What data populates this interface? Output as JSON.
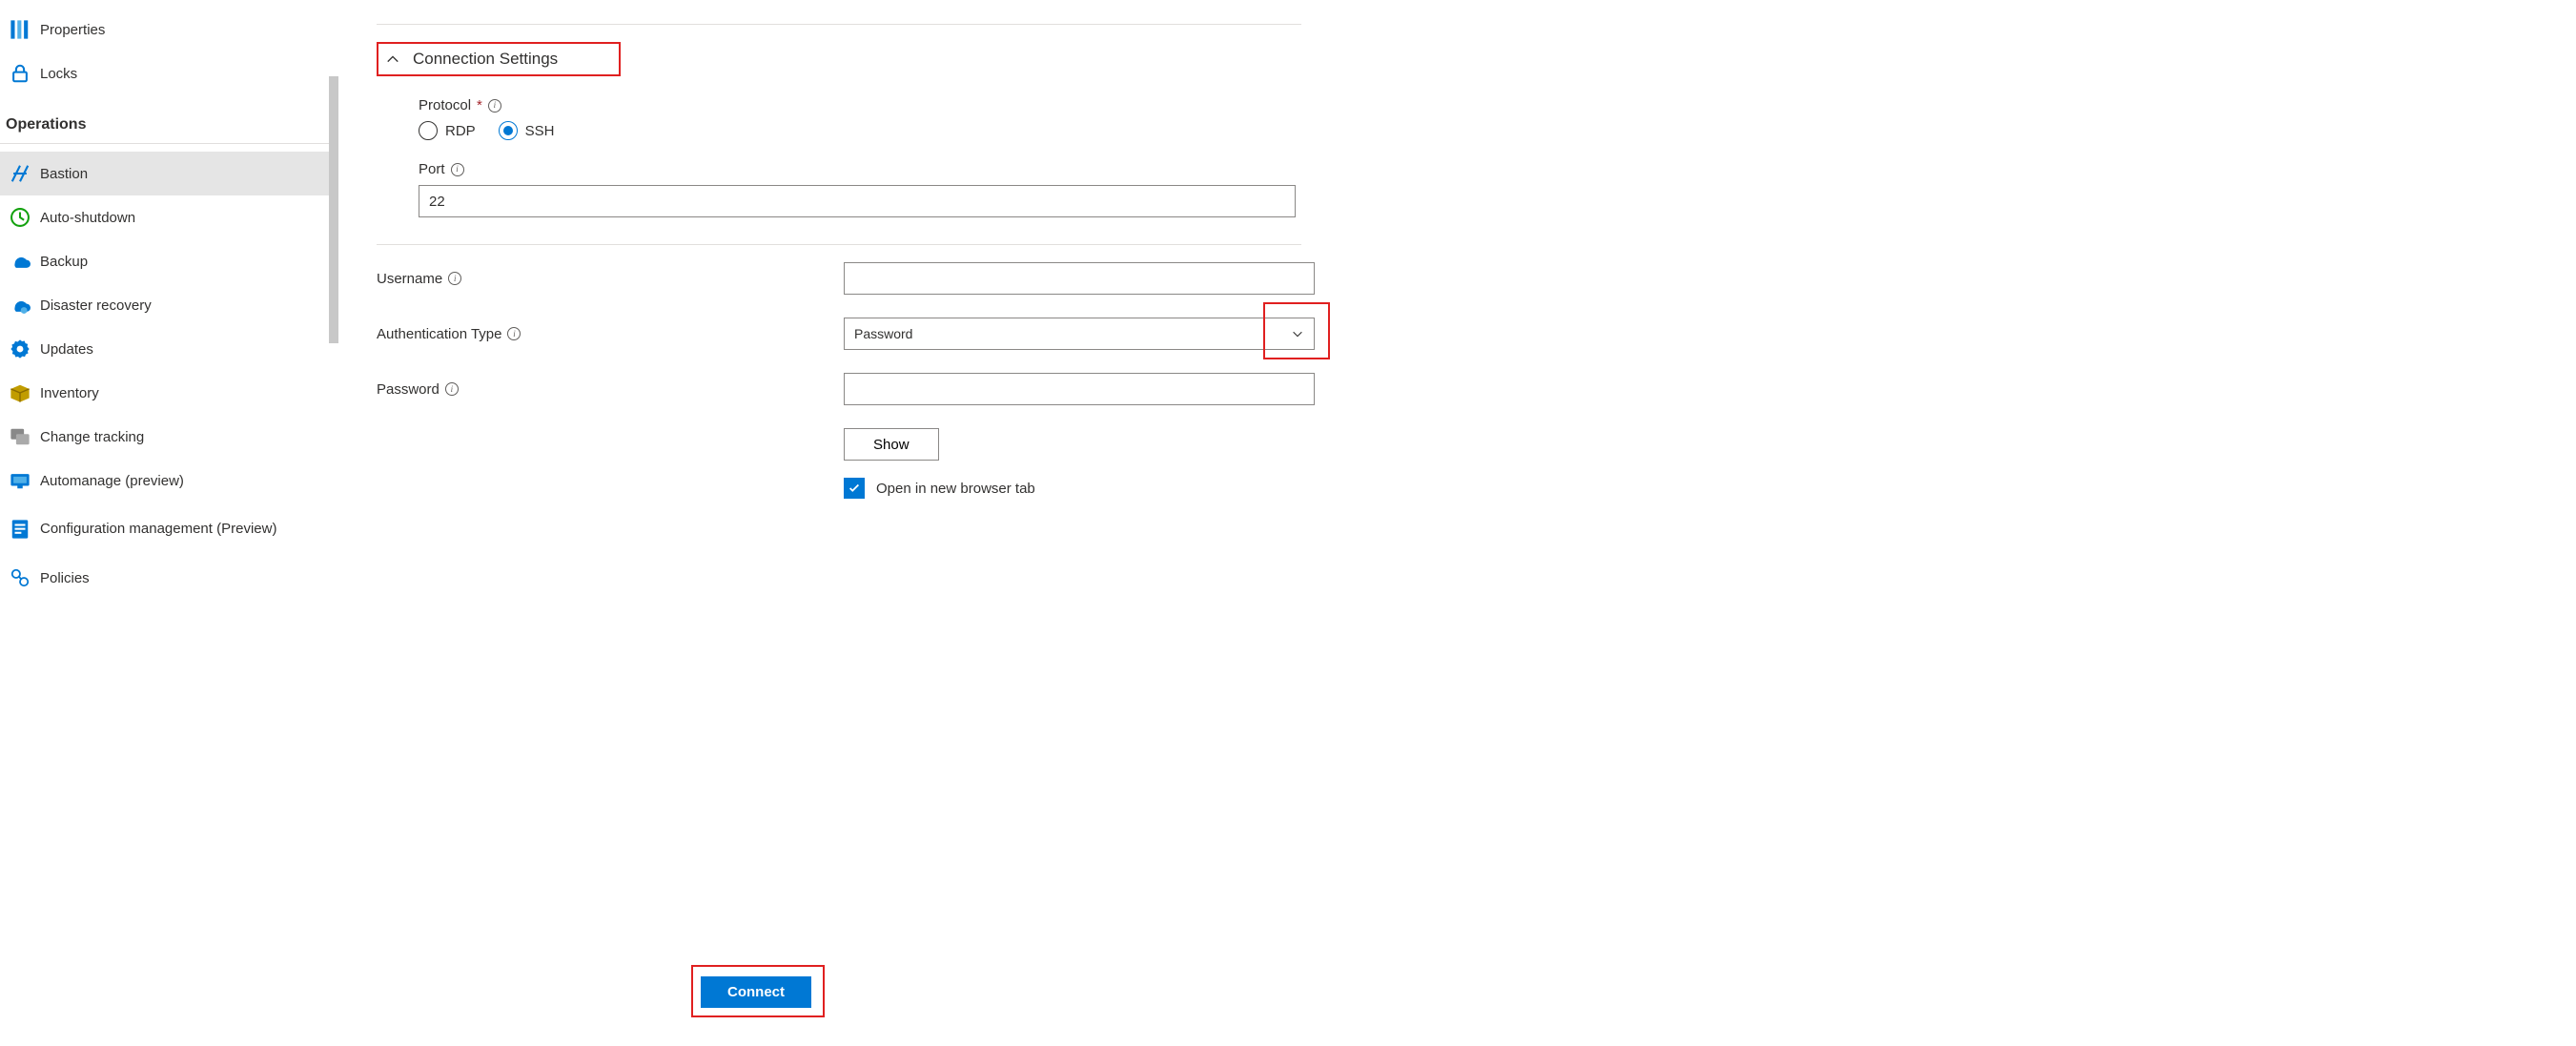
{
  "sidebar": {
    "items1": [
      {
        "label": "Properties",
        "icon": "properties"
      },
      {
        "label": "Locks",
        "icon": "lock"
      }
    ],
    "section": "Operations",
    "items2": [
      {
        "label": "Bastion",
        "icon": "bastion",
        "selected": true
      },
      {
        "label": "Auto-shutdown",
        "icon": "clock"
      },
      {
        "label": "Backup",
        "icon": "backup"
      },
      {
        "label": "Disaster recovery",
        "icon": "dr"
      },
      {
        "label": "Updates",
        "icon": "gear"
      },
      {
        "label": "Inventory",
        "icon": "package"
      },
      {
        "label": "Change tracking",
        "icon": "tracking"
      },
      {
        "label": "Automanage (preview)",
        "icon": "automanage"
      },
      {
        "label": "Configuration management (Preview)",
        "icon": "config"
      },
      {
        "label": "Policies",
        "icon": "policies"
      }
    ]
  },
  "main": {
    "sectionTitle": "Connection Settings",
    "protocolLabel": "Protocol",
    "protocolOptions": {
      "rdp": "RDP",
      "ssh": "SSH"
    },
    "portLabel": "Port",
    "portValue": "22",
    "usernameLabel": "Username",
    "usernameValue": "",
    "authLabel": "Authentication Type",
    "authValue": "Password",
    "passwordLabel": "Password",
    "passwordValue": "",
    "showLabel": "Show",
    "newTabLabel": "Open in new browser tab",
    "connectLabel": "Connect"
  }
}
